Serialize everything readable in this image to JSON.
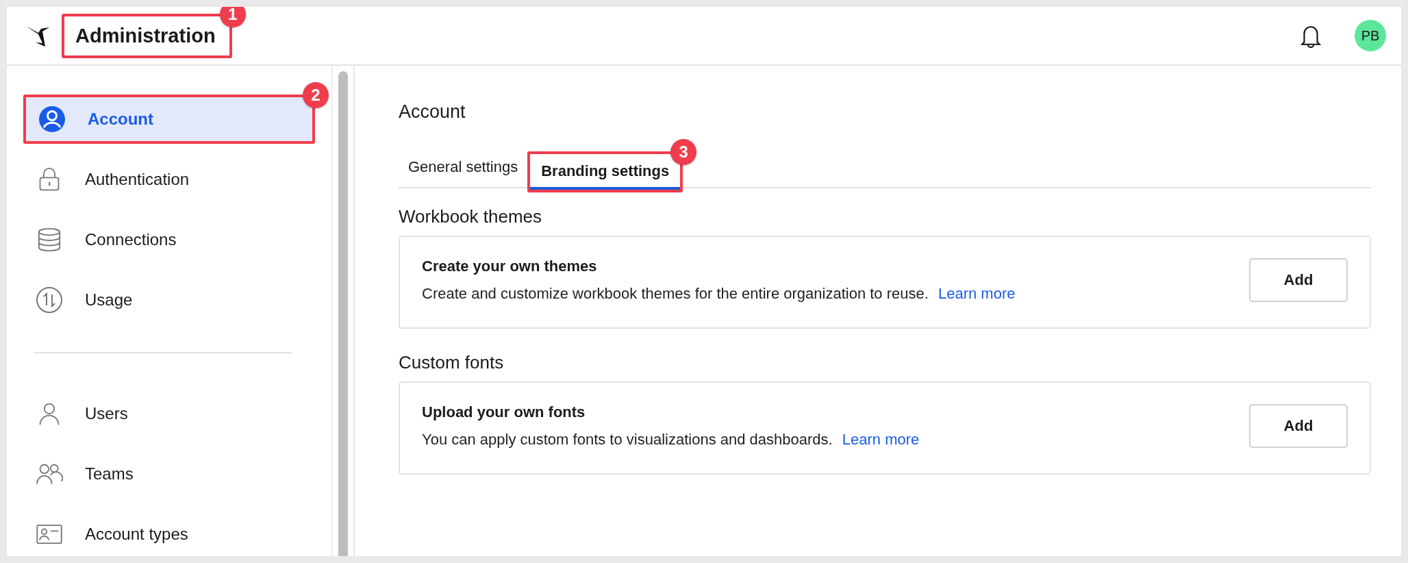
{
  "header": {
    "title": "Administration",
    "callout": "1",
    "avatar": "PB"
  },
  "sidebar": {
    "groups": [
      {
        "items": [
          {
            "label": "Account",
            "selected": true,
            "callout": "2"
          },
          {
            "label": "Authentication",
            "selected": false
          },
          {
            "label": "Connections",
            "selected": false
          },
          {
            "label": "Usage",
            "selected": false
          }
        ]
      },
      {
        "items": [
          {
            "label": "Users",
            "selected": false
          },
          {
            "label": "Teams",
            "selected": false
          },
          {
            "label": "Account types",
            "selected": false
          }
        ]
      }
    ]
  },
  "content": {
    "heading": "Account",
    "tabs": [
      {
        "label": "General settings",
        "selected": false
      },
      {
        "label": "Branding settings",
        "selected": true,
        "callout": "3"
      }
    ],
    "sections": [
      {
        "heading": "Workbook themes",
        "card": {
          "title": "Create your own themes",
          "text": "Create and customize workbook themes for the entire organization to reuse.",
          "link": "Learn more",
          "button": "Add"
        }
      },
      {
        "heading": "Custom fonts",
        "card": {
          "title": "Upload your own fonts",
          "text": "You can apply custom fonts to visualizations and dashboards.",
          "link": "Learn more",
          "button": "Add"
        }
      }
    ]
  }
}
